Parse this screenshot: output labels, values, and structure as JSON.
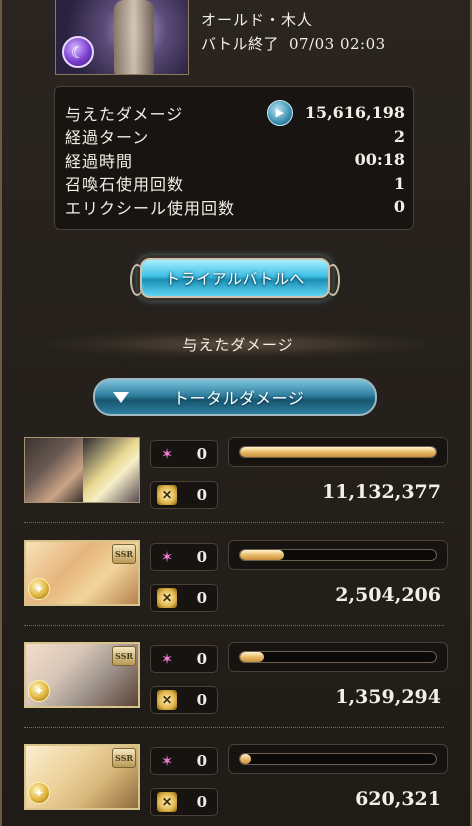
{
  "quest": {
    "name": "オールド・木人",
    "status": "バトル終了",
    "datetime": "07/03 02:03"
  },
  "summary": {
    "rows": [
      {
        "label": "与えたダメージ",
        "value": "15,616,198"
      },
      {
        "label": "経過ターン",
        "value": "2"
      },
      {
        "label": "経過時間",
        "value": "00:18"
      },
      {
        "label": "召喚石使用回数",
        "value": "1"
      },
      {
        "label": "エリクシール使用回数",
        "value": "0"
      }
    ]
  },
  "trial_button": "トライアルバトルへ",
  "section_title": "与えたダメージ",
  "total_dropdown": "トータルダメージ",
  "characters": [
    {
      "ougi": "0",
      "chain": "0",
      "damage": "11,132,377",
      "share": 1.0,
      "ssr": false
    },
    {
      "ougi": "0",
      "chain": "0",
      "damage": "2,504,206",
      "share": 0.225,
      "ssr": true,
      "badge": "SSR"
    },
    {
      "ougi": "0",
      "chain": "0",
      "damage": "1,359,294",
      "share": 0.122,
      "ssr": true,
      "badge": "SSR"
    },
    {
      "ougi": "0",
      "chain": "0",
      "damage": "620,321",
      "share": 0.056,
      "ssr": true,
      "badge": "SSR"
    }
  ],
  "icons": {
    "element": "light-element-icon",
    "ougi": "ougi-star-icon",
    "chain": "chain-burst-icon",
    "play": "play-icon"
  },
  "colors": {
    "bar_fill": "#e9bd6a",
    "trial_button": "#3fbfe4",
    "dropdown": "#2f7f9e"
  }
}
